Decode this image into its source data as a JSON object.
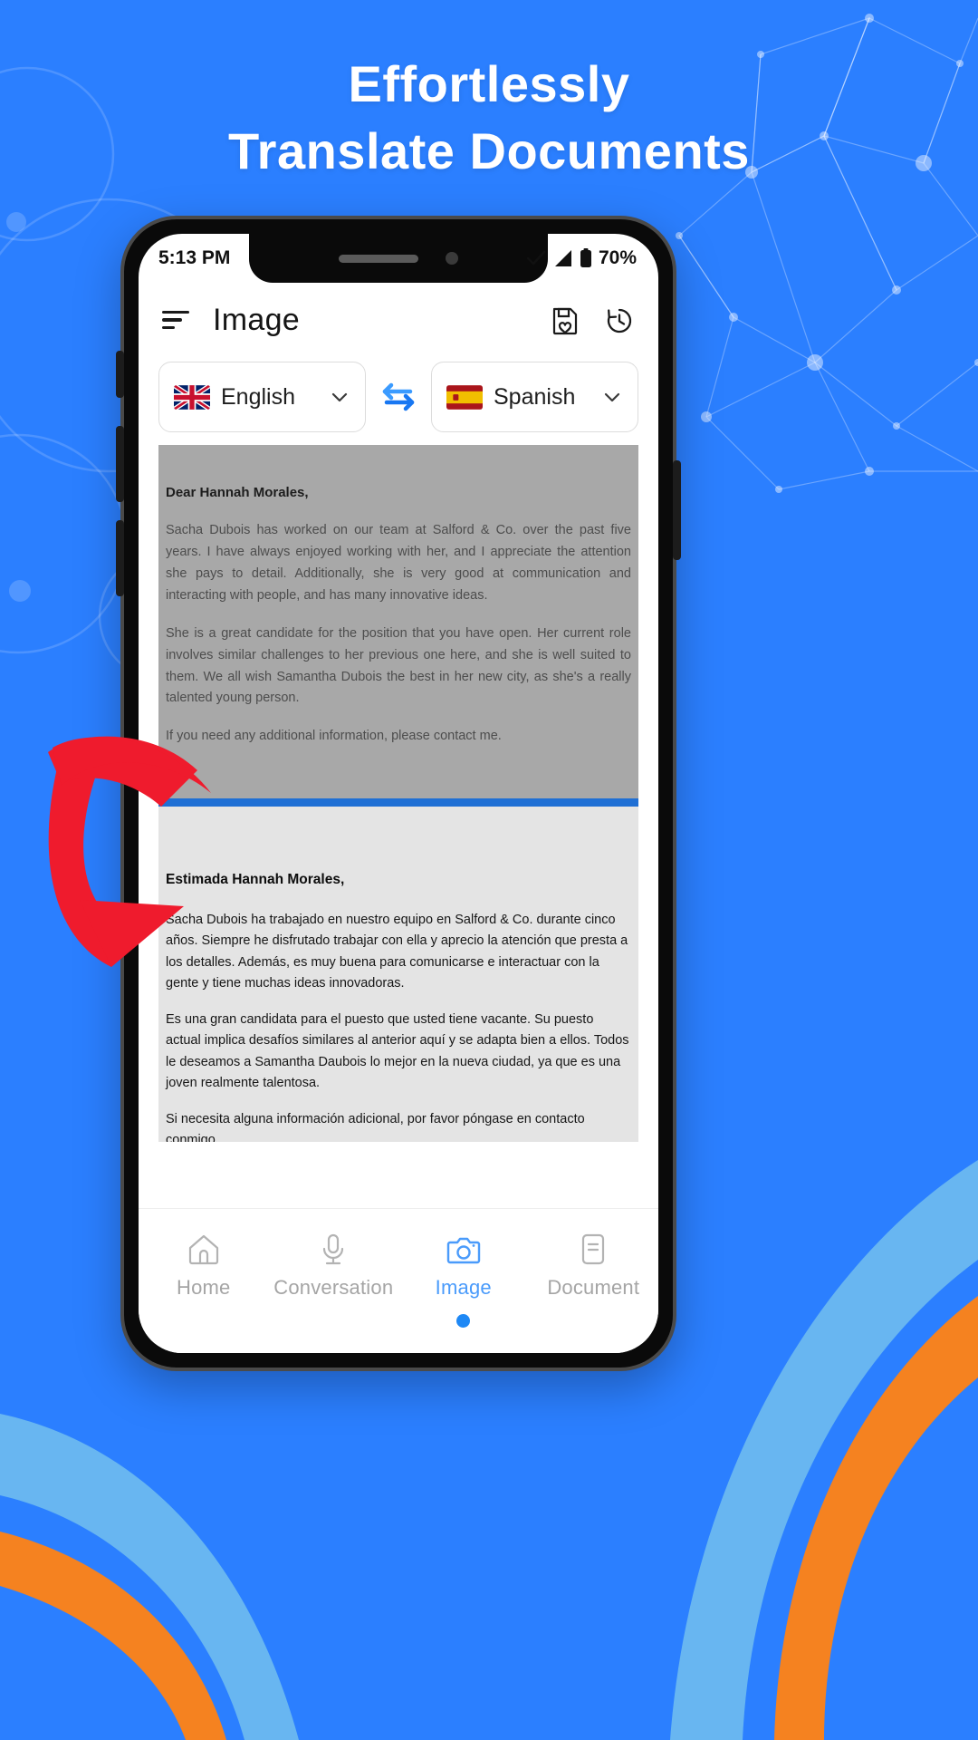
{
  "headline": {
    "line1": "Effortlessly",
    "line2": "Translate Documents"
  },
  "colors": {
    "background": "#2b7fff",
    "accent": "#1e88f5",
    "arrow": "#ef1b2d",
    "wave_orange": "#f58220",
    "wave_light_blue": "#6bb9f0",
    "divider_blue": "#1f6fd4"
  },
  "phone": {
    "statusbar": {
      "time": "5:13 PM",
      "battery_percent": "70%",
      "icons": [
        "check-icon",
        "signal-icon",
        "battery-icon"
      ]
    },
    "header": {
      "menu_icon": "hamburger-menu-icon",
      "title": "Image",
      "actions": [
        {
          "name": "save-favorite-icon",
          "label": "Saved"
        },
        {
          "name": "history-icon",
          "label": "History"
        }
      ]
    },
    "language_bar": {
      "source": {
        "language": "English",
        "flag": "uk-flag",
        "chevron": "chevron-down-icon"
      },
      "swap": {
        "name": "swap-languages-icon"
      },
      "target": {
        "language": "Spanish",
        "flag": "spain-flag",
        "chevron": "chevron-down-icon"
      }
    },
    "source_document": {
      "salutation": "Dear Hannah Morales,",
      "paragraphs": [
        "Sacha Dubois has worked on our team at Salford & Co. over the past five years. I have always enjoyed working with her, and I appreciate the attention she pays to detail. Additionally, she is very good at communication and interacting with people, and has many innovative ideas.",
        "She is a great candidate for the position that you have open. Her current role involves similar challenges to her previous one here, and she is well suited to them. We all wish Samantha Dubois the best in her new city, as she's a really talented young person.",
        "If you need any additional information, please contact me."
      ]
    },
    "target_document": {
      "salutation": "Estimada Hannah Morales,",
      "paragraphs": [
        "Sacha Dubois ha trabajado en nuestro equipo en Salford & Co. durante cinco años. Siempre he disfrutado trabajar con ella y aprecio la atención que presta a los detalles. Además, es muy buena para comunicarse e interactuar con la gente y tiene muchas ideas innovadoras.",
        "Es una gran candidata para el puesto que usted tiene vacante. Su puesto actual implica desafíos similares al anterior aquí y se adapta bien a ellos. Todos le deseamos a Samantha Daubois lo mejor en la nueva ciudad, ya que es una joven realmente talentosa.",
        "Si necesita alguna información adicional, por favor póngase en contacto conmigo."
      ]
    },
    "bottom_nav": {
      "items": [
        {
          "label": "Home",
          "icon": "home-icon",
          "active": false
        },
        {
          "label": "Conversation",
          "icon": "microphone-icon",
          "active": false
        },
        {
          "label": "Image",
          "icon": "camera-icon",
          "active": true
        },
        {
          "label": "Document",
          "icon": "document-icon",
          "active": false
        }
      ]
    }
  }
}
